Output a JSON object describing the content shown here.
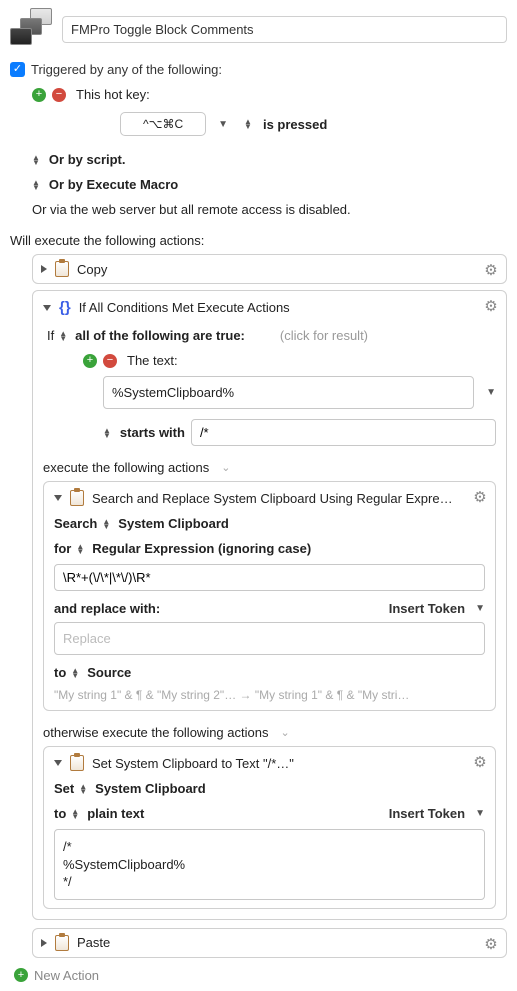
{
  "header": {
    "macro_title": "FMPro Toggle Block Comments"
  },
  "trigger": {
    "triggered_label": "Triggered by any of the following:",
    "hotkey_label": "This hot key:",
    "hotkey_value": "^⌥⌘C",
    "hotkey_state": "is pressed",
    "by_script": "Or by script.",
    "by_execute_macro": "Or by Execute Macro",
    "web_server_note": "Or via the web server but all remote access is disabled."
  },
  "exec_header": "Will execute the following actions:",
  "actions": {
    "copy_label": "Copy",
    "paste_label": "Paste"
  },
  "cond": {
    "title": "If All Conditions Met Execute Actions",
    "if_label": "If",
    "all_true": "all of the following are true:",
    "click_for_result": "(click for result)",
    "text_label": "The text:",
    "token_value": "%SystemClipboard%",
    "starts_with": "starts with",
    "starts_with_value": "/*",
    "execute_label": "execute the following actions",
    "otherwise_label": "otherwise execute the following actions"
  },
  "search_replace": {
    "title": "Search and Replace System Clipboard Using Regular Expre…",
    "search_label": "Search",
    "target": "System Clipboard",
    "for_label": "for",
    "mode": "Regular Expression (ignoring case)",
    "pattern": "\\R*+(\\/\\*|\\*\\/)\\R*",
    "replace_label": "and replace with:",
    "insert_token": "Insert Token",
    "replace_placeholder": "Replace",
    "to_label": "to",
    "to_target": "Source",
    "example": "\"My string 1\" & ¶  & \"My string 2\"… → \"My string 1\" & ¶  & \"My stri…"
  },
  "set_clip": {
    "title": "Set System Clipboard to Text \"/*…\"",
    "set_label": "Set",
    "target": "System Clipboard",
    "to_label": "to",
    "format": "plain text",
    "insert_token": "Insert Token",
    "body_line1": "/*",
    "body_line2": "%SystemClipboard%",
    "body_line3": "*/"
  },
  "footer": {
    "new_action": "New Action"
  }
}
